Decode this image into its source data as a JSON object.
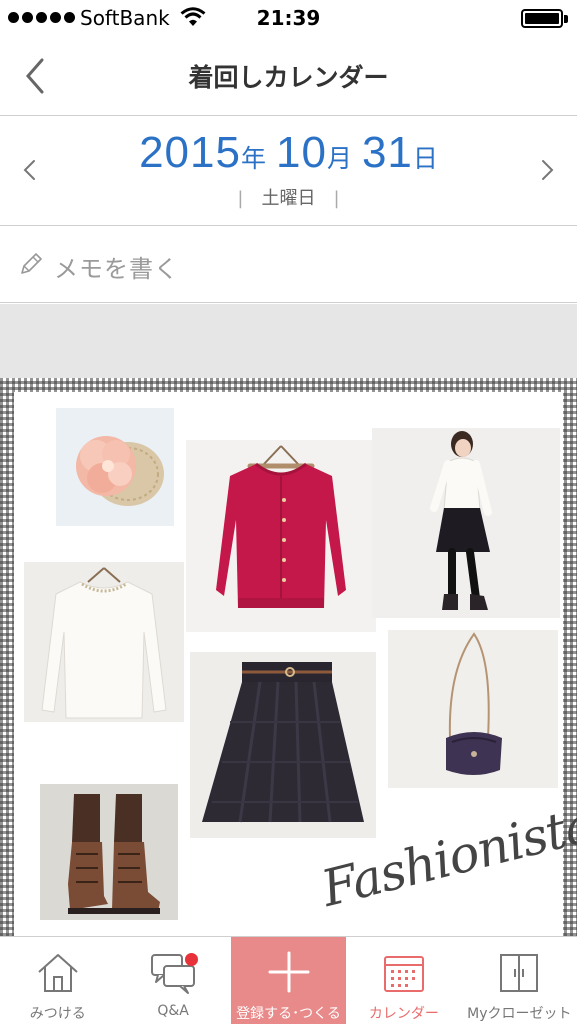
{
  "status_bar": {
    "carrier": "SoftBank",
    "time": "21:39"
  },
  "nav": {
    "title": "着回しカレンダー",
    "back_icon": "chevron-left-icon"
  },
  "date": {
    "year": "2015",
    "year_unit": "年",
    "month": "10",
    "month_unit": "月",
    "day": "31",
    "day_unit": "日",
    "weekday": "土曜日",
    "color": "#2b72c7"
  },
  "memo": {
    "placeholder": "メモを書く",
    "icon": "pencil-icon"
  },
  "collage": {
    "brand_text": "Fashionista",
    "items": [
      {
        "name": "hair-accessory",
        "icon": "flower-corsage"
      },
      {
        "name": "red-cardigan",
        "icon": "cardigan"
      },
      {
        "name": "model-photo",
        "icon": "person"
      },
      {
        "name": "white-top",
        "icon": "blouse"
      },
      {
        "name": "navy-skirt",
        "icon": "skirt"
      },
      {
        "name": "shoulder-bag",
        "icon": "bag"
      },
      {
        "name": "brown-boots",
        "icon": "boots"
      }
    ]
  },
  "tab_bar": {
    "tabs": [
      {
        "label": "みつける",
        "icon": "home-icon"
      },
      {
        "label": "Q&A",
        "icon": "chat-bubbles-icon",
        "badge_color": "#e8323a"
      },
      {
        "label": "登録する･つくる",
        "icon": "plus-icon",
        "background": "#e98a8a"
      },
      {
        "label": "カレンダー",
        "icon": "calendar-icon",
        "active_color": "#e86c6c"
      },
      {
        "label": "Myクローゼット",
        "icon": "closet-icon"
      }
    ]
  }
}
